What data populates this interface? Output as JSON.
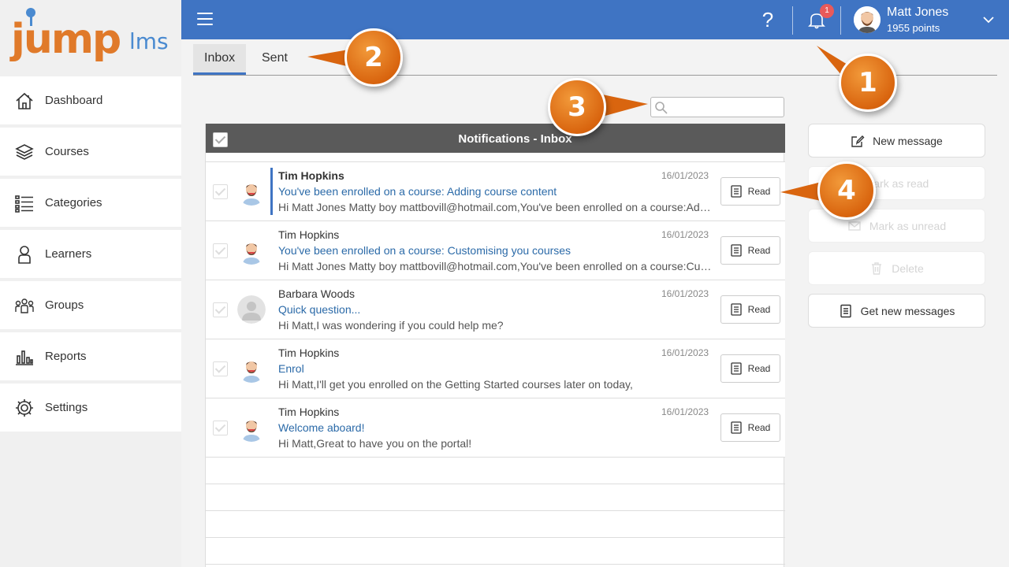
{
  "brand": {
    "logo_main": "jump",
    "logo_suffix": "lms",
    "accent": "#3f74c3",
    "orange": "#e07a2a"
  },
  "sidebar": {
    "items": [
      {
        "label": "Dashboard",
        "icon": "home-icon"
      },
      {
        "label": "Courses",
        "icon": "courses-icon"
      },
      {
        "label": "Categories",
        "icon": "categories-icon"
      },
      {
        "label": "Learners",
        "icon": "learner-icon"
      },
      {
        "label": "Groups",
        "icon": "groups-icon"
      },
      {
        "label": "Reports",
        "icon": "reports-icon"
      },
      {
        "label": "Settings",
        "icon": "settings-icon"
      }
    ]
  },
  "header": {
    "help_label": "?",
    "notification_count": "1",
    "user_name": "Matt Jones",
    "user_points": "1955 points"
  },
  "tabs": [
    {
      "label": "Inbox",
      "active": true
    },
    {
      "label": "Sent",
      "active": false
    }
  ],
  "search": {
    "placeholder": ""
  },
  "inbox": {
    "title": "Notifications - Inbox",
    "read_label": "Read",
    "messages": [
      {
        "sender": "Tim Hopkins",
        "subject": "You've been enrolled on a course: Adding course content",
        "preview": "Hi Matt Jones Matty boy mattbovill@hotmail.com,You've been enrolled on a course:Adding course content",
        "date": "16/01/2023",
        "selected": true
      },
      {
        "sender": "Tim Hopkins",
        "subject": "You've been enrolled on a course: Customising you courses",
        "preview": "Hi Matt Jones Matty boy mattbovill@hotmail.com,You've been enrolled on a course:Customising you courses",
        "date": "16/01/2023",
        "selected": false
      },
      {
        "sender": "Barbara Woods",
        "subject": "Quick question...",
        "preview": "Hi Matt,I was wondering if you could help me?",
        "date": "16/01/2023",
        "selected": false
      },
      {
        "sender": "Tim Hopkins",
        "subject": "Enrol",
        "preview": "Hi Matt,I'll get you enrolled on the Getting Started courses later on today,",
        "date": "16/01/2023",
        "selected": false
      },
      {
        "sender": "Tim Hopkins",
        "subject": "Welcome aboard!",
        "preview": "Hi Matt,Great to have you on the portal!",
        "date": "16/01/2023",
        "selected": false
      }
    ]
  },
  "actions": {
    "new_message": "New message",
    "mark_read": "Mark as read",
    "mark_unread": "Mark as unread",
    "delete": "Delete",
    "get_new": "Get new messages"
  },
  "callouts": {
    "one": "1",
    "two": "2",
    "three": "3",
    "four": "4"
  }
}
